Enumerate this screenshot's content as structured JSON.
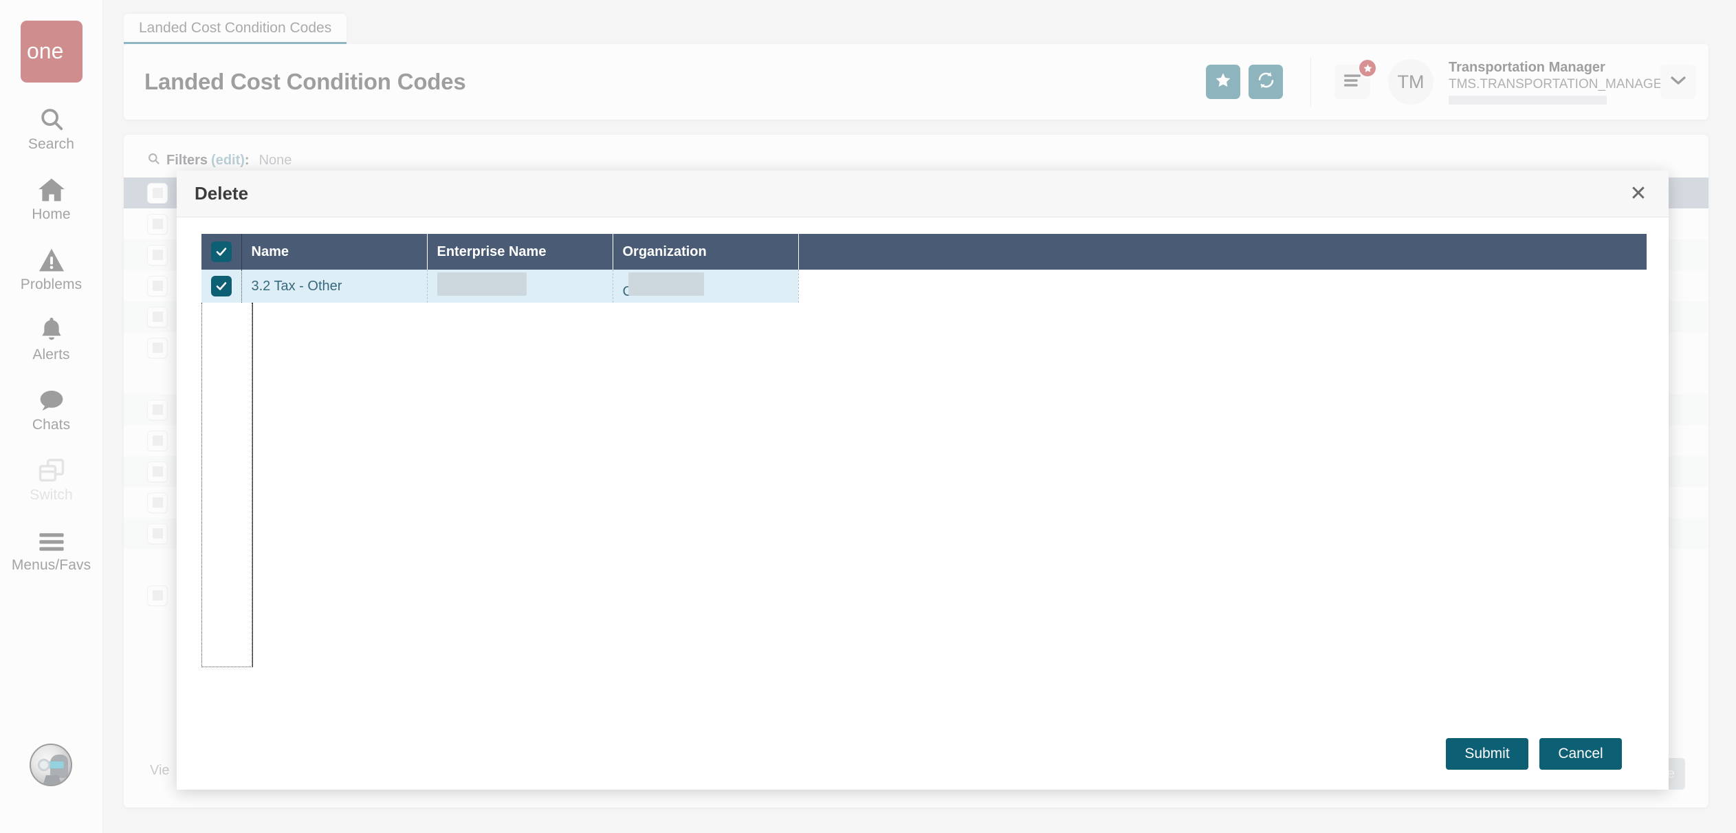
{
  "colors": {
    "brand_red": "#9b0a0a",
    "teal": "#0d5f74",
    "table_header": "#495b75",
    "row_selected": "#ddeef6",
    "badge_red": "#b01217"
  },
  "sidebar": {
    "logo_text": "one",
    "items": [
      {
        "label": "Search",
        "icon": "search-icon",
        "disabled": false
      },
      {
        "label": "Home",
        "icon": "home-icon",
        "disabled": false
      },
      {
        "label": "Problems",
        "icon": "problems-icon",
        "disabled": false
      },
      {
        "label": "Alerts",
        "icon": "bell-icon",
        "disabled": false
      },
      {
        "label": "Chats",
        "icon": "chat-icon",
        "disabled": false
      },
      {
        "label": "Switch",
        "icon": "switch-icon",
        "disabled": true
      },
      {
        "label": "Menus/Favs",
        "icon": "hamburger-icon",
        "disabled": false
      }
    ],
    "avatar_name": "robot-avatar"
  },
  "tabs": [
    {
      "label": "Landed Cost Condition Codes",
      "active": true
    }
  ],
  "header": {
    "title": "Landed Cost Condition Codes",
    "favorite_icon": "star-icon",
    "refresh_icon": "refresh-icon",
    "menu_icon": "menu-lines-icon",
    "menu_badge_icon": "star-badge-icon",
    "avatar_initials": "TM",
    "user_name": "Transportation Manager",
    "user_login": "TMS.TRANSPORTATION_MANAGER",
    "caret_icon": "chevron-down-icon"
  },
  "filters": {
    "icon": "search-icon",
    "label": "Filters",
    "edit_label": "(edit)",
    "colon": ":",
    "value": "None"
  },
  "background_page": {
    "footer_text": "Vie",
    "delete_button_label": "Delete",
    "delete_button_disabled": true,
    "row_count": 12
  },
  "modal": {
    "title": "Delete",
    "close_icon": "close-icon",
    "table": {
      "select_all_checked": true,
      "columns": [
        "Name",
        "Enterprise Name",
        "Organization"
      ],
      "rows": [
        {
          "checked": true,
          "name": "3.2 Tax - Other",
          "enterprise_name": "",
          "organization": "C"
        }
      ]
    },
    "submit_label": "Submit",
    "cancel_label": "Cancel"
  }
}
